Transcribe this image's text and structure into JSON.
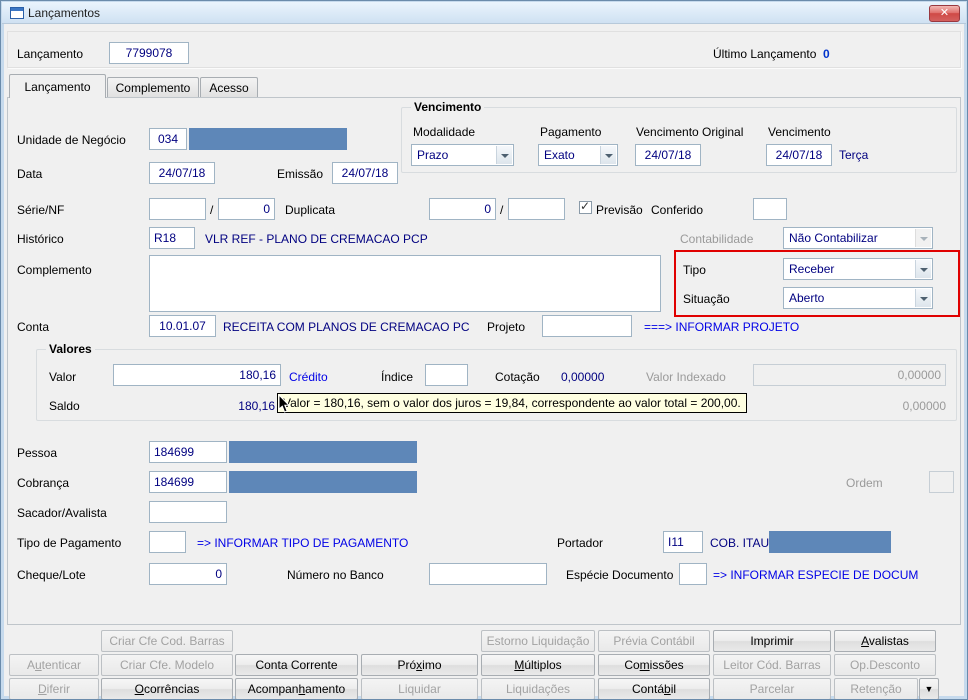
{
  "window": {
    "title": "Lançamentos"
  },
  "icons": {
    "close": "✕",
    "check": "✓"
  },
  "header": {
    "lancamento_label": "Lançamento",
    "lancamento_value": "7799078",
    "ultimo_label": "Último Lançamento",
    "ultimo_value": "0"
  },
  "tabs": {
    "lancamento": "Lançamento",
    "complemento": "Complemento",
    "acesso": "Acesso"
  },
  "form": {
    "unidade_label": "Unidade de Negócio",
    "unidade_value": "034",
    "venc": {
      "title": "Vencimento",
      "modalidade_label": "Modalidade",
      "modalidade_value": "Prazo",
      "pagamento_label": "Pagamento",
      "pagamento_value": "Exato",
      "original_label": "Vencimento Original",
      "original_value": "24/07/18",
      "vencimento_label": "Vencimento",
      "vencimento_value": "24/07/18",
      "weekday": "Terça"
    },
    "data_label": "Data",
    "data_value": "24/07/18",
    "emissao_label": "Emissão",
    "emissao_value": "24/07/18",
    "serie_label": "Série/NF",
    "serie_slash": "/",
    "serie_num": "0",
    "duplicata_label": "Duplicata",
    "duplicata_num": "0",
    "duplicata_slash": "/",
    "previsao_label": "Previsão",
    "previsao_checked": true,
    "conferido_label": "Conferido",
    "historico_label": "Histórico",
    "historico_code": "R18",
    "historico_desc": "VLR REF - PLANO DE CREMACAO PCP",
    "contabilidade_label": "Contabilidade",
    "contabilidade_value": "Não Contabilizar",
    "complemento_label": "Complemento",
    "tipo_label": "Tipo",
    "tipo_value": "Receber",
    "situacao_label": "Situação",
    "situacao_value": "Aberto",
    "conta_label": "Conta",
    "conta_code": "10.01.07",
    "conta_desc": "RECEITA COM PLANOS DE CREMACAO PC",
    "projeto_label": "Projeto",
    "projeto_hint": "===> INFORMAR PROJETO",
    "valores": {
      "title": "Valores",
      "valor_label": "Valor",
      "valor_value": "180,16",
      "credito": "Crédito",
      "indice_label": "Índice",
      "cotacao_label": "Cotação",
      "cotacao_value": "0,00000",
      "valor_indexado_label": "Valor Indexado",
      "valor_indexado_value": "0,00000",
      "saldo_label": "Saldo",
      "saldo_value": "180,16",
      "saldo_indexado_value": "0,00000"
    },
    "tooltip": "Valor = 180,16, sem o valor dos juros = 19,84, correspondente ao valor total = 200,00.",
    "pessoa_label": "Pessoa",
    "pessoa_value": "184699",
    "cobranca_label": "Cobrança",
    "cobranca_value": "184699",
    "ordem_label": "Ordem",
    "sacador_label": "Sacador/Avalista",
    "tipo_pagamento_label": "Tipo de Pagamento",
    "tipo_pagamento_hint": "=> INFORMAR TIPO DE PAGAMENTO",
    "portador_label": "Portador",
    "portador_code": "I11",
    "portador_desc": "COB. ITAU",
    "cheque_label": "Cheque/Lote",
    "cheque_value": "0",
    "numero_banco_label": "Número no Banco",
    "especie_label": "Espécie Documento",
    "especie_hint": "=> INFORMAR ESPECIE DE DOCUM"
  },
  "buttons": {
    "row1": [
      {
        "label": "Criar Cfe Cod. Barras",
        "disabled": true
      },
      {
        "label": "Estorno Liquidação",
        "disabled": true
      },
      {
        "label": "Prévia Contábil",
        "disabled": true
      },
      {
        "label": "Imprimir",
        "disabled": false
      },
      {
        "label": "Avalistas",
        "disabled": false,
        "u": 0
      }
    ],
    "row2": [
      {
        "label": "Autenticar",
        "disabled": true,
        "u": 1
      },
      {
        "label": "Criar Cfe. Modelo",
        "disabled": true
      },
      {
        "label": "Conta Corrente",
        "disabled": false
      },
      {
        "label": "Próximo",
        "disabled": false,
        "u": 3
      },
      {
        "label": "Múltiplos",
        "disabled": false,
        "u": 0
      },
      {
        "label": "Comissões",
        "disabled": false,
        "u": 2
      },
      {
        "label": "Leitor Cód. Barras",
        "disabled": true
      },
      {
        "label": "Op.Desconto",
        "disabled": true
      }
    ],
    "row3": [
      {
        "label": "Diferir",
        "disabled": true,
        "u": 0
      },
      {
        "label": "Ocorrências",
        "disabled": false,
        "u": 0
      },
      {
        "label": "Acompanhamento",
        "disabled": false,
        "u": 7
      },
      {
        "label": "Liquidar",
        "disabled": true
      },
      {
        "label": "Liquidações",
        "disabled": true
      },
      {
        "label": "Contábil",
        "disabled": false,
        "u": 5
      },
      {
        "label": "Parcelar",
        "disabled": true
      },
      {
        "label": "Retenção",
        "disabled": true
      },
      {
        "label": "▼",
        "disabled": false,
        "arrow": true
      }
    ]
  },
  "colors": {
    "value_text": "#000080",
    "hint_text": "#0000e6",
    "redaction": "#5e87b8",
    "highlight_border": "#e00000"
  }
}
